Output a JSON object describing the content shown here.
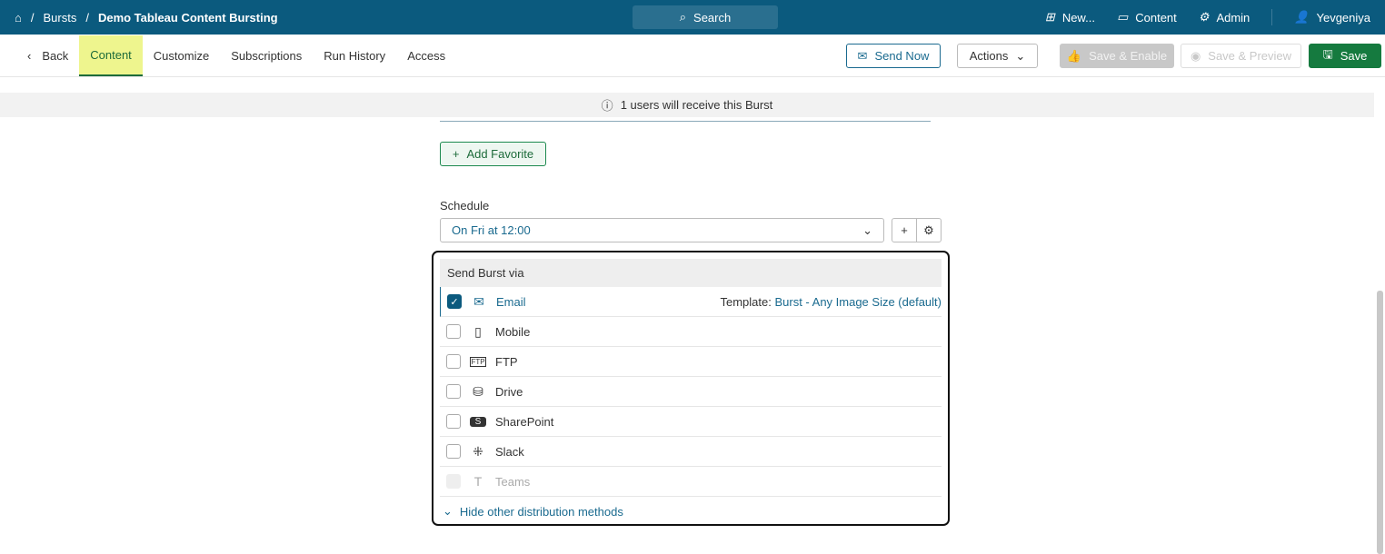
{
  "breadcrumb": {
    "home_icon": "home-icon",
    "items": [
      "Bursts",
      "Demo Tableau Content Bursting"
    ]
  },
  "search": {
    "label": "Search"
  },
  "top_menu": {
    "new": "New...",
    "content": "Content",
    "admin": "Admin",
    "user": "Yevgeniya"
  },
  "tabs": {
    "back": "Back",
    "items": [
      "Content",
      "Customize",
      "Subscriptions",
      "Run History",
      "Access"
    ],
    "active": "Content"
  },
  "toolbar": {
    "send_now": "Send Now",
    "actions": "Actions",
    "save_enable": "Save & Enable",
    "save_preview": "Save & Preview",
    "save": "Save"
  },
  "banner": {
    "text": "1 users will receive this Burst"
  },
  "favorite": {
    "add_label": "Add Favorite"
  },
  "schedule": {
    "label": "Schedule",
    "value": "On Fri at 12:00"
  },
  "send_via": {
    "title": "Send Burst via",
    "template_label": "Template:",
    "template_value": "Burst - Any Image Size (default)",
    "methods": [
      {
        "label": "Email",
        "checked": true
      },
      {
        "label": "Mobile",
        "checked": false
      },
      {
        "label": "FTP",
        "checked": false
      },
      {
        "label": "Drive",
        "checked": false
      },
      {
        "label": "SharePoint",
        "checked": false
      },
      {
        "label": "Slack",
        "checked": false
      },
      {
        "label": "Teams",
        "checked": false,
        "disabled": true
      }
    ],
    "toggle": "Hide other distribution methods"
  },
  "colors": {
    "header": "#0b5a7e",
    "save": "#157a3f",
    "active_tab": "#eef58e"
  }
}
